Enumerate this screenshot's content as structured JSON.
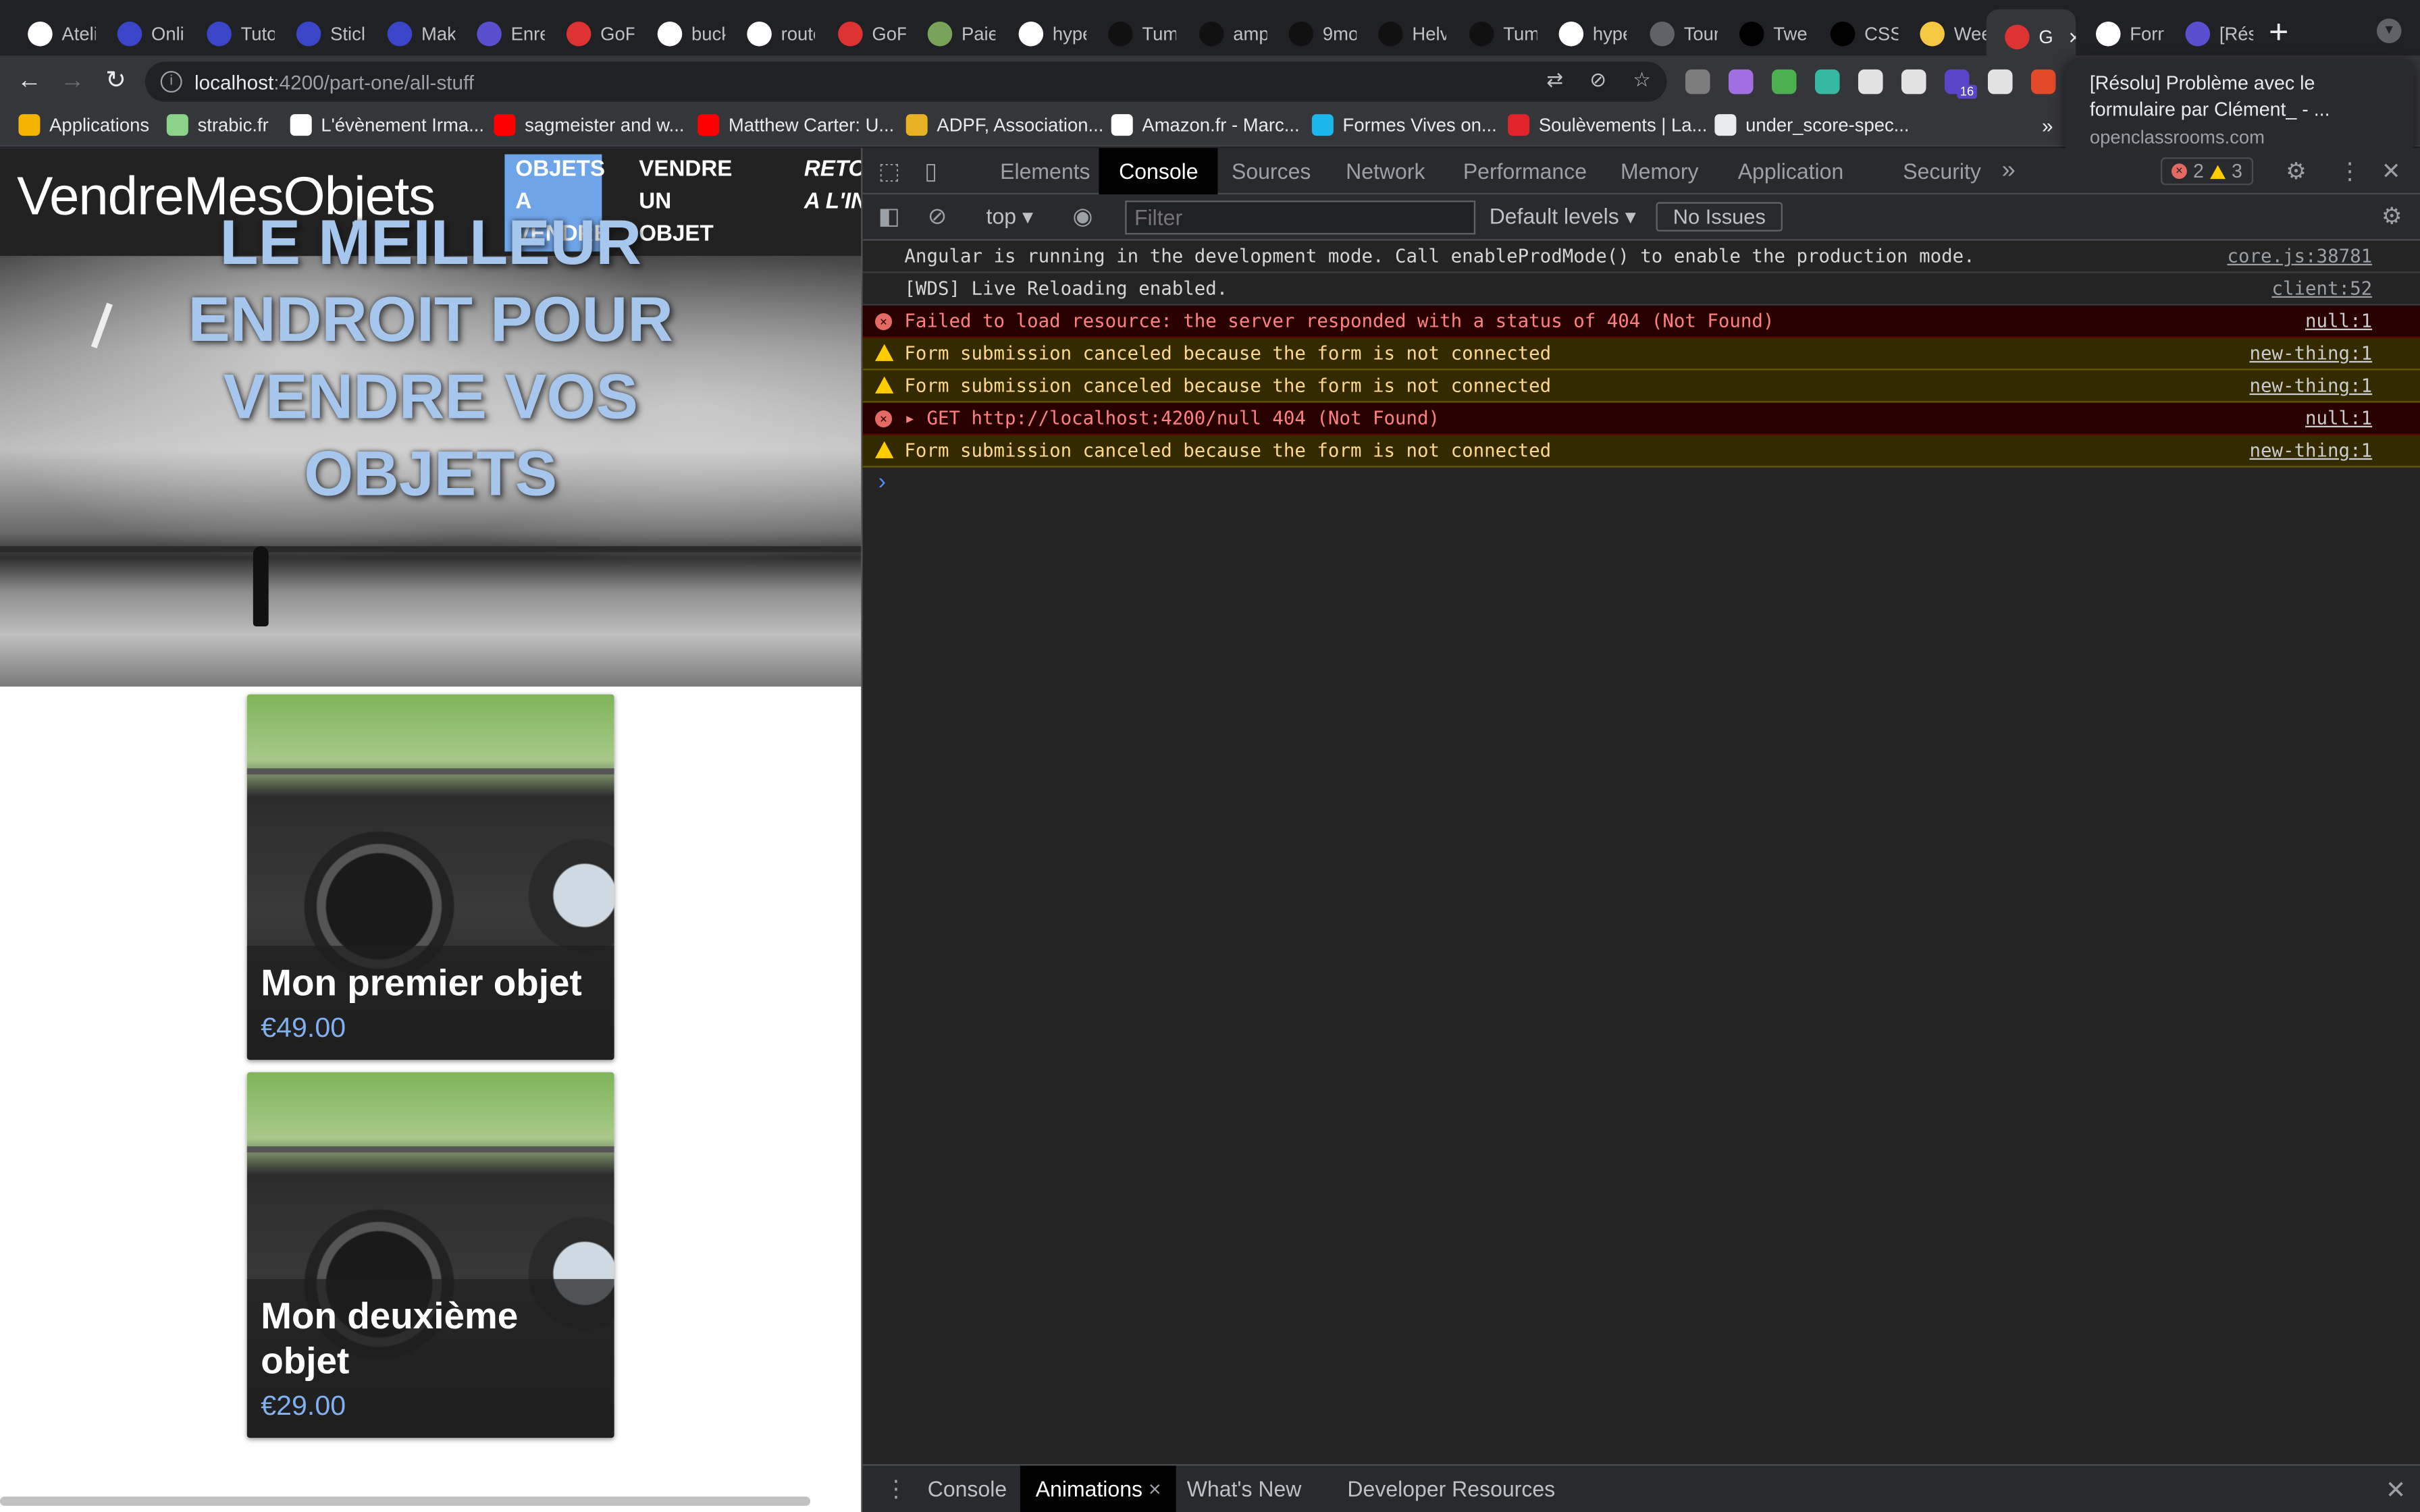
{
  "tabs": [
    {
      "label": "Atelie",
      "favicon": "github-icon",
      "color": "#ffffff"
    },
    {
      "label": "Onlin",
      "favicon": "smiley-icon",
      "color": "#3b45c7"
    },
    {
      "label": "Tutor",
      "favicon": "smiley-icon",
      "color": "#3b45c7"
    },
    {
      "label": "Stick",
      "favicon": "smiley-icon",
      "color": "#3b45c7"
    },
    {
      "label": "Maki",
      "favicon": "smiley-icon",
      "color": "#3b45c7"
    },
    {
      "label": "Enre",
      "favicon": "openclassrooms-icon",
      "color": "#5a4fcf"
    },
    {
      "label": "GoFu",
      "favicon": "angular-icon",
      "color": "#dd3333"
    },
    {
      "label": "buck",
      "favicon": "google-icon",
      "color": "#ffffff"
    },
    {
      "label": "route",
      "favicon": "google-icon",
      "color": "#ffffff"
    },
    {
      "label": "GoFu",
      "favicon": "angular-icon",
      "color": "#dd3333"
    },
    {
      "label": "Paier",
      "favicon": "mountain-icon",
      "color": "#7aa35a"
    },
    {
      "label": "hype",
      "favicon": "google-icon",
      "color": "#ffffff"
    },
    {
      "label": "Tumi",
      "favicon": "feather-icon",
      "color": "#111111"
    },
    {
      "label": "amp",
      "favicon": "feather-icon",
      "color": "#111111"
    },
    {
      "label": "9mo",
      "favicon": "feather-icon",
      "color": "#111111"
    },
    {
      "label": "Helv",
      "favicon": "feather-icon",
      "color": "#111111"
    },
    {
      "label": "Tum",
      "favicon": "feather-icon",
      "color": "#111111"
    },
    {
      "label": "hype",
      "favicon": "google-icon",
      "color": "#ffffff"
    },
    {
      "label": "Tour",
      "favicon": "globe-icon",
      "color": "#5f6368"
    },
    {
      "label": "Twe",
      "favicon": "medium-icon",
      "color": "#000000"
    },
    {
      "label": "CSS",
      "favicon": "medium-icon",
      "color": "#000000"
    },
    {
      "label": "Wee",
      "favicon": "note-icon",
      "color": "#f4c842"
    },
    {
      "label": "G",
      "favicon": "angular-icon",
      "color": "#dd3333",
      "active": true
    },
    {
      "label": "Form",
      "favicon": "google-icon",
      "color": "#ffffff"
    },
    {
      "label": "[Rés",
      "favicon": "openclassrooms-icon",
      "color": "#5a4fcf"
    }
  ],
  "omnibox": {
    "host": "localhost",
    "path": ":4200/part-one/all-stuff"
  },
  "extensions": [
    {
      "name": "translate-icon",
      "color": "#8ab4f8"
    },
    {
      "name": "eye-off-icon",
      "color": "#bdc1c6"
    },
    {
      "name": "star-icon",
      "color": "#bdc1c6"
    }
  ],
  "toolbar_exts": [
    "#7d7d7d",
    "#a36fe0",
    "#4caf50",
    "#35b9a0",
    "#e2e2e2",
    "#e2e2e2",
    "#5a44c7",
    "#e2e2e2",
    "#e34a2a"
  ],
  "ext_badge": "16",
  "bookmarks": [
    {
      "label": "Applications",
      "icon": "apps-icon",
      "color": "#f4b400"
    },
    {
      "label": "strabic.fr",
      "icon": "circle-icon",
      "color": "#8ad28a"
    },
    {
      "label": "L'évènement Irma...",
      "icon": "lines-icon",
      "color": "#ffffff"
    },
    {
      "label": "sagmeister and w...",
      "icon": "youtube-icon",
      "color": "#ff0000"
    },
    {
      "label": "Matthew Carter: U...",
      "icon": "youtube-icon",
      "color": "#ff0000"
    },
    {
      "label": "ADPF, Association...",
      "icon": "b-icon",
      "color": "#e8b024"
    },
    {
      "label": "Amazon.fr - Marc...",
      "icon": "amazon-icon",
      "color": "#ffffff"
    },
    {
      "label": "Formes Vives on...",
      "icon": "vimeo-icon",
      "color": "#1ab7ea"
    },
    {
      "label": "Soulèvements | La...",
      "icon": "s-icon",
      "color": "#e0242a"
    },
    {
      "label": "under_score-spec...",
      "icon": "globe-icon",
      "color": "#e8eaed"
    }
  ],
  "popup": {
    "title": "[Résolu] Problème avec le formulaire par Clément_ - ...",
    "domain": "openclassrooms.com"
  },
  "app": {
    "brand": "VendreMesObjets",
    "nav": [
      "Objets a vendre",
      "Vendre un objet",
      "Retour a l'indi"
    ],
    "hero_title": "Le meilleur endroit pour vendre vos objets",
    "items": [
      {
        "title": "Mon premier objet",
        "price": "€49.00"
      },
      {
        "title": "Mon deuxième objet",
        "price": "€29.00"
      }
    ]
  },
  "devtools": {
    "tabs": [
      "Elements",
      "Console",
      "Sources",
      "Network",
      "Performance",
      "Memory",
      "Application",
      "Security"
    ],
    "active_tab": "Console",
    "error_count": "2",
    "warning_count": "3",
    "context": "top",
    "filter_placeholder": "Filter",
    "levels": "Default levels",
    "issues": "No Issues",
    "messages": [
      {
        "level": "info",
        "text": "Angular is running in the development mode. Call enableProdMode() to enable the production mode.",
        "source": "core.js:38781"
      },
      {
        "level": "info",
        "text": "[WDS] Live Reloading enabled.",
        "source": "client:52"
      },
      {
        "level": "error",
        "text": "Failed to load resource: the server responded with a status of 404 (Not Found)",
        "source": "null:1"
      },
      {
        "level": "warning",
        "text": "Form submission canceled because the form is not connected",
        "source": "new-thing:1"
      },
      {
        "level": "warning",
        "text": "Form submission canceled because the form is not connected",
        "source": "new-thing:1"
      },
      {
        "level": "error",
        "text": "▸ GET http://localhost:4200/null 404 (Not Found)",
        "source": "null:1"
      },
      {
        "level": "warning",
        "text": "Form submission canceled because the form is not connected",
        "source": "new-thing:1"
      }
    ],
    "drawer_tabs": [
      "Console",
      "Animations",
      "What's New",
      "Developer Resources"
    ],
    "drawer_active": "Animations"
  }
}
